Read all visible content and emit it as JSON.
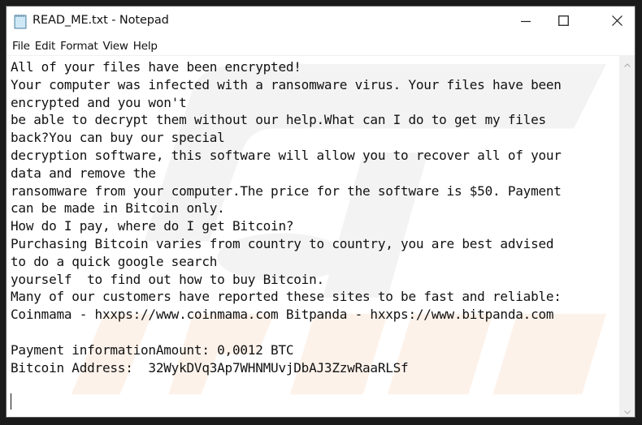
{
  "window": {
    "title": "READ_ME.txt - Notepad",
    "app_icon": "notepad-icon",
    "controls": {
      "minimize": "minimize-icon",
      "maximize": "maximize-icon",
      "close": "close-icon"
    }
  },
  "menubar": {
    "items": [
      {
        "label": "File"
      },
      {
        "label": "Edit"
      },
      {
        "label": "Format"
      },
      {
        "label": "View"
      },
      {
        "label": "Help"
      }
    ]
  },
  "editor": {
    "lines": [
      "All of your files have been encrypted!",
      "Your computer was infected with a ransomware virus. Your files have been",
      "encrypted and you won't",
      "be able to decrypt them without our help.What can I do to get my files",
      "back?You can buy our special",
      "decryption software, this software will allow you to recover all of your",
      "data and remove the",
      "ransomware from your computer.The price for the software is $50. Payment",
      "can be made in Bitcoin only.",
      "How do I pay, where do I get Bitcoin?",
      "Purchasing Bitcoin varies from country to country, you are best advised",
      "to do a quick google search",
      "yourself  to find out how to buy Bitcoin.",
      "Many of our customers have reported these sites to be fast and reliable:",
      "Coinmama - hxxps://www.coinmama.com Bitpanda - hxxps://www.bitpanda.com",
      "",
      "Payment informationAmount: 0,0012 BTC",
      "Bitcoin Address:  32WykDVq3Ap7WHNMUvjDbAJ3ZzwRaaRLSf",
      ""
    ]
  },
  "scrollbar": {
    "up_icon": "chevron-up-icon",
    "down_icon": "chevron-down-icon"
  },
  "colors": {
    "desktop": "#1b1b1b",
    "window_bg": "#ffffff",
    "text": "#111111",
    "scrollbar_track": "#f0f0f0",
    "watermark_gray": "#f2f2f2",
    "watermark_orange": "#fdf1e8"
  }
}
